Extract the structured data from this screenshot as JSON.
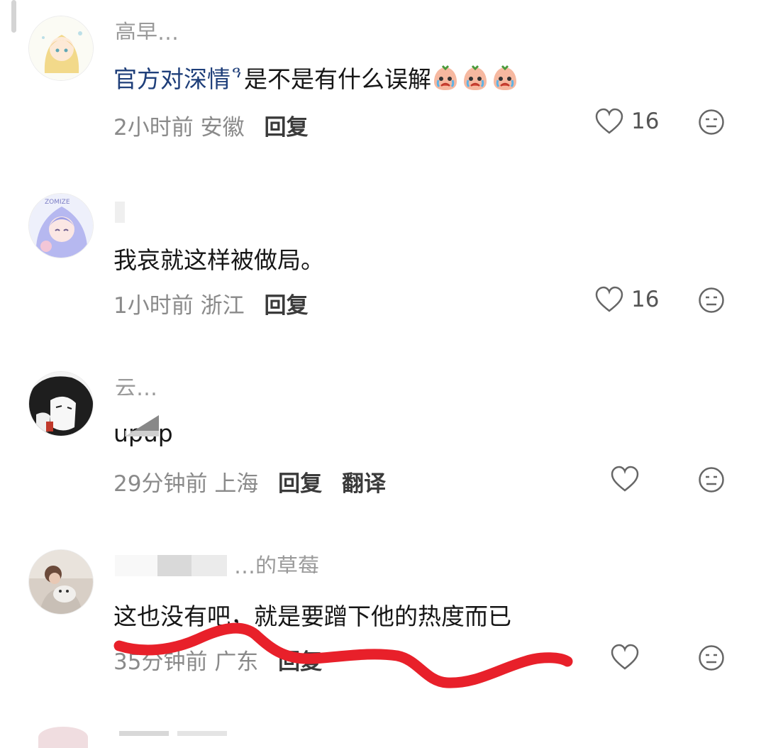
{
  "comments": [
    {
      "username": "高早…",
      "content_name": "官方对深情",
      "content_text": "是不是有什么误解",
      "emoji": "crying-face-emoji",
      "time": "2小时前",
      "location": "安徽",
      "reply": "回复",
      "likes": "16"
    },
    {
      "username": "",
      "content_text": "我哀就这样被做局。",
      "time": "1小时前",
      "location": "浙江",
      "reply": "回复",
      "likes": "16"
    },
    {
      "username": "云…",
      "content_text": "upup",
      "time": "29分钟前",
      "location": "上海",
      "reply": "回复",
      "translate": "翻译",
      "likes": ""
    },
    {
      "username": "…的草莓",
      "content_text": "这也没有吧，就是要蹭下他的热度而已",
      "time": "35分钟前",
      "location": "广东",
      "reply": "回复",
      "likes": ""
    }
  ],
  "colors": {
    "link": "#1f3f7a",
    "meta": "#8a8a8a",
    "annotation": "#e8202a"
  },
  "icons": [
    "heart-outline-icon",
    "neutral-face-icon",
    "pin-icon"
  ]
}
